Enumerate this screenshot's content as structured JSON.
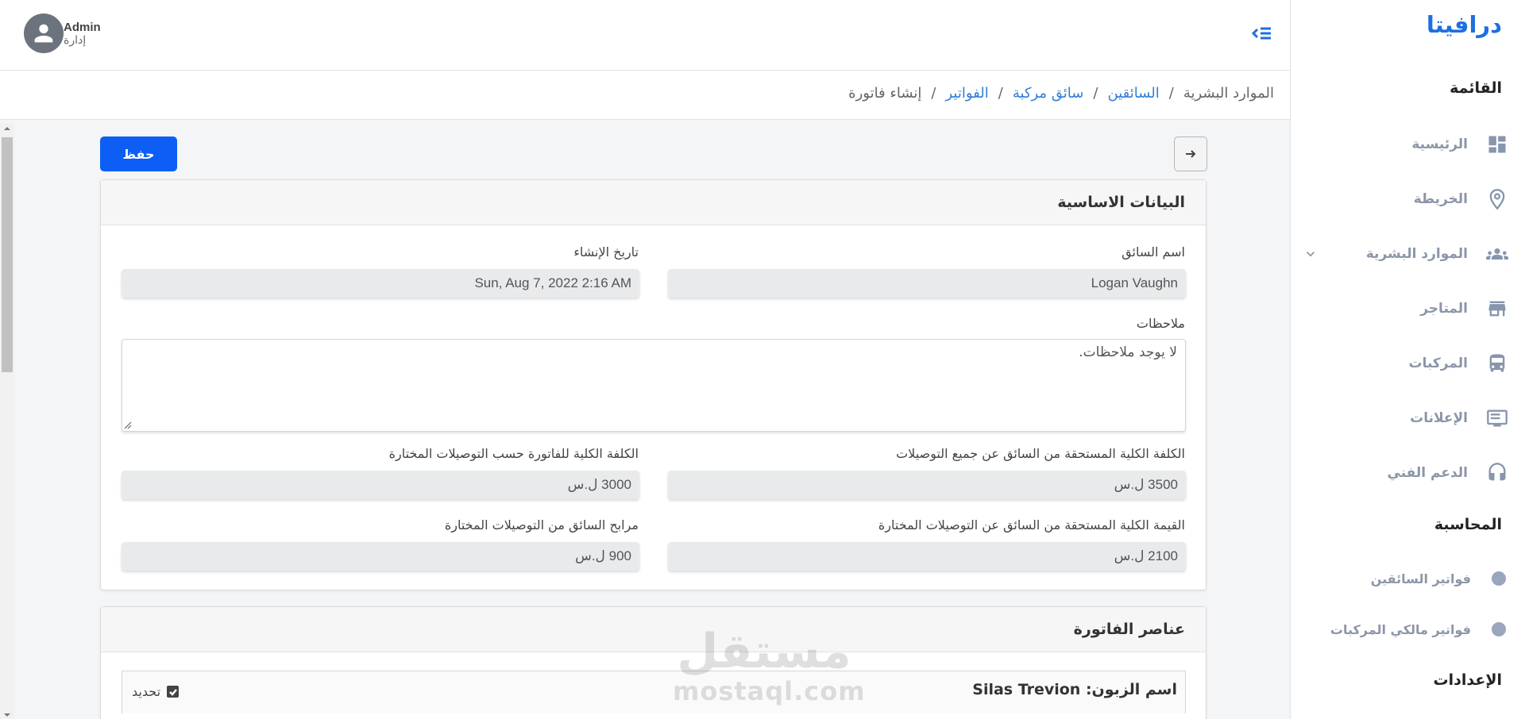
{
  "sidebar": {
    "brand": "درافيتا",
    "menu_title": "القائمة",
    "items": [
      {
        "label": "الرئيسية",
        "icon": "dashboard-icon"
      },
      {
        "label": "الخريطة",
        "icon": "map-pin-icon"
      },
      {
        "label": "الموارد البشرية",
        "icon": "people-icon"
      },
      {
        "label": "المتاجر",
        "icon": "store-icon"
      },
      {
        "label": "المركبات",
        "icon": "bus-icon"
      },
      {
        "label": "الإعلانات",
        "icon": "monitor-icon"
      },
      {
        "label": "الدعم الفني",
        "icon": "headset-icon"
      }
    ],
    "accounting_title": "المحاسبة",
    "accounting_items": [
      {
        "label": "فواتير السائقين"
      },
      {
        "label": "فواتير مالكي المركبات"
      }
    ],
    "settings_title": "الإعدادات"
  },
  "topbar": {
    "user_name": "Admin",
    "user_role": "إدارة"
  },
  "breadcrumb": {
    "items": [
      "الموارد البشرية",
      "السائقين",
      "سائق مركبة",
      "الفواتير",
      "إنشاء فاتورة"
    ],
    "separator": "/"
  },
  "actions": {
    "save_label": "حفظ"
  },
  "basic_info": {
    "title": "البيانات الاساسية",
    "driver_name_label": "اسم السائق",
    "driver_name_value": "Logan Vaughn",
    "created_at_label": "تاريخ الإنشاء",
    "created_at_value": "Sun, Aug 7, 2022 2:16 AM",
    "notes_label": "ملاحظات",
    "notes_value": "لا يوجد ملاحظات.",
    "total_due_all_label": "الكلفة الكلية المستحقة من السائق عن جميع التوصيلات",
    "total_due_all_value": "3500 ل.س",
    "total_invoice_selected_label": "الكلفة الكلية للفاتورة حسب التوصيلات المختارة",
    "total_invoice_selected_value": "3000 ل.س",
    "total_due_selected_label": "القيمة الكلية المستحقة من السائق عن التوصيلات المختارة",
    "total_due_selected_value": "2100 ل.س",
    "driver_profit_label": "مرابح السائق من التوصيلات المختارة",
    "driver_profit_value": "900 ل.س"
  },
  "invoice_items": {
    "title": "عناصر الفاتورة",
    "customer_label": "اسم الزبون:",
    "customer_value": "Silas Trevion",
    "select_label": "تحديد"
  },
  "watermark": {
    "ar": "مستقل",
    "en": "mostaql.com"
  },
  "colors": {
    "primary": "#0d5ef5",
    "link": "#2f7ed8",
    "brand": "#1f6fe0"
  }
}
